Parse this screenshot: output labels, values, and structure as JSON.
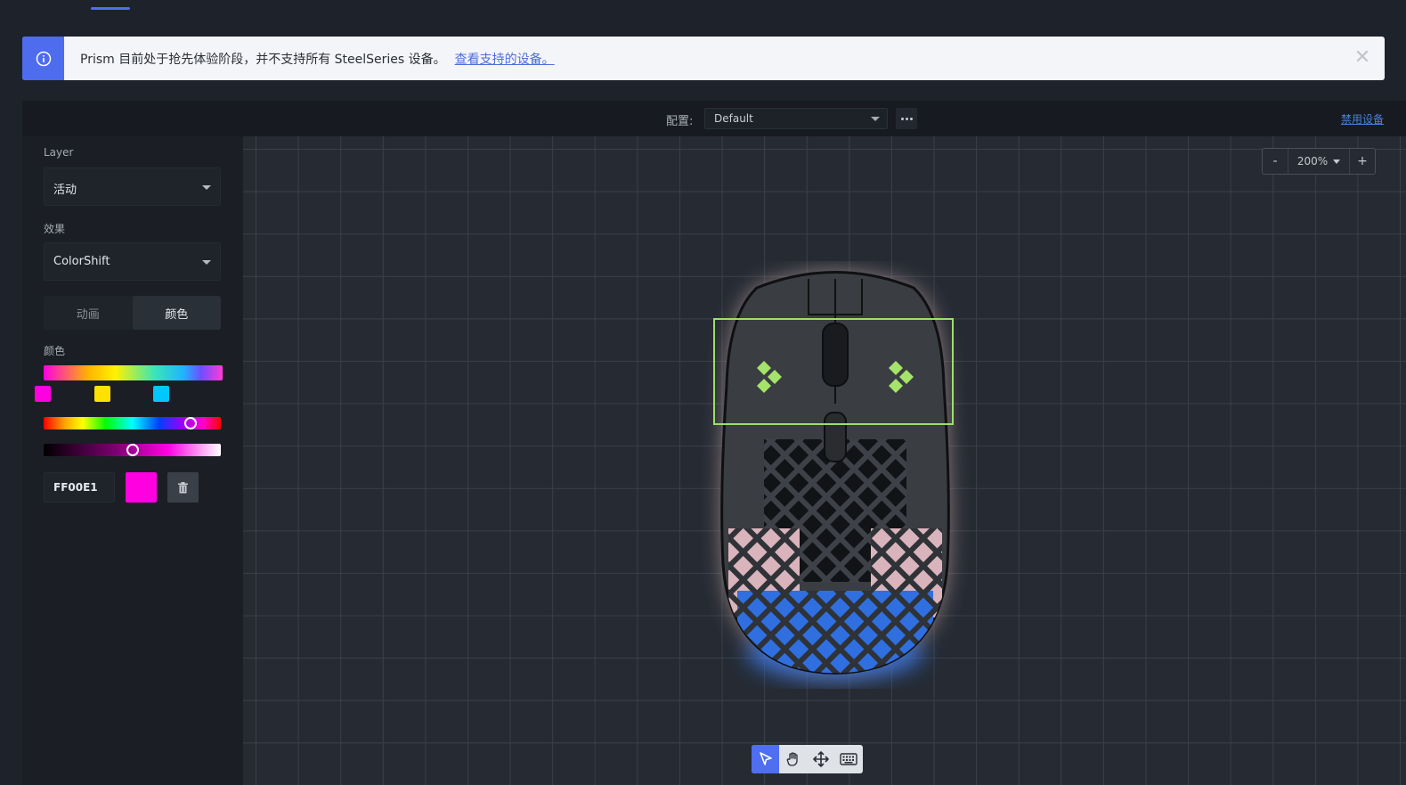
{
  "notice": {
    "text": "Prism 目前处于抢先体验阶段，并不支持所有 SteelSeries 设备。",
    "link": "查看支持的设备。",
    "close": "✕",
    "accent": "#4e6cee"
  },
  "toolbar": {
    "profile_label": "配置:",
    "profile_value": "Default",
    "disable_link": "禁用设备"
  },
  "sidebar": {
    "layer_label": "Layer",
    "layer_value": "活动",
    "effect_label": "效果",
    "effect_value": "ColorShift",
    "tabs": [
      {
        "label": "动画",
        "active": false
      },
      {
        "label": "颜色",
        "active": true
      }
    ],
    "color_label": "颜色",
    "gradient_stops": [
      "#ff00e1",
      "#ffe100",
      "#00c8ff"
    ],
    "hex_value": "FF00E1",
    "swatch_color": "#ff00e1"
  },
  "zoom": {
    "minus": "-",
    "value": "200%",
    "plus": "+"
  },
  "tools": [
    {
      "name": "select-tool",
      "active": true
    },
    {
      "name": "hand-tool",
      "active": false
    },
    {
      "name": "move-tool",
      "active": false
    },
    {
      "name": "keyboard-tool",
      "active": false
    }
  ]
}
